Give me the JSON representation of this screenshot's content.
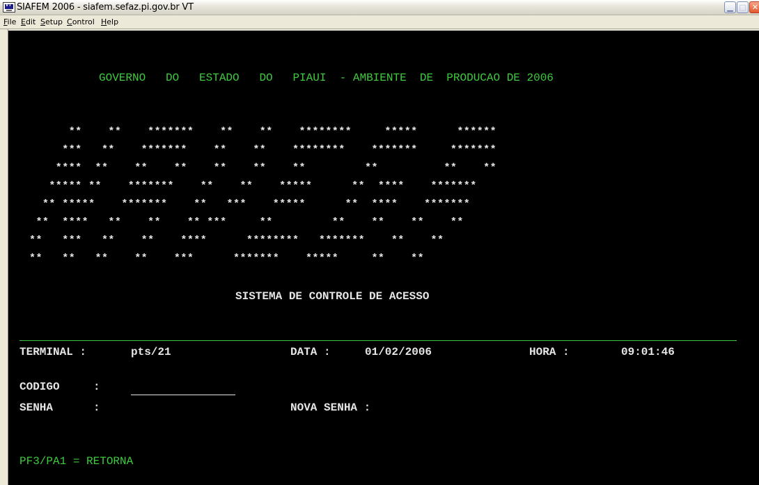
{
  "window": {
    "title": "SIAFEM 2006 - siafem.sefaz.pi.gov.br VT",
    "icon_label": "VT"
  },
  "menu": {
    "items": [
      "File",
      "Edit",
      "Setup",
      "Control",
      "Help"
    ]
  },
  "terminal": {
    "header": "GOVERNO   DO   ESTADO   DO   PIAUI  - AMBIENTE  DE  PRODUCAO DE 2006",
    "ascii_art": [
      "      **    **    *******    **    **    ********     *****      ******",
      "     ***   **    *******    **    **    ********    *******     *******",
      "    ****  **    **    **    **    **    **         **          **    **",
      "   ***** **    *******    **    **    *****      **  ****    *******",
      "  ** *****    *******    **   ***    *****      **  ****    *******",
      " **  ****   **    **    ** ***     **         **    **    **    **",
      "**   ***   **    **    ****      ********   *******    **    **",
      "**   **   **    **    ***      *******    *****     **    **"
    ],
    "system_title": "SISTEMA DE CONTROLE DE ACESSO",
    "terminal_label": "TERMINAL :",
    "terminal_value": "pts/21",
    "data_label": "DATA :",
    "data_value": "01/02/2006",
    "hora_label": "HORA :",
    "hora_value": "09:01:46",
    "codigo_label": "CODIGO",
    "codigo_colon": ":",
    "codigo_value": "",
    "senha_label": "SENHA",
    "senha_colon": ":",
    "nova_senha_label": "NOVA SENHA :",
    "pf_help": "PF3/PA1 = RETORNA"
  },
  "colors": {
    "terminal_bg": "#000000",
    "green": "#3DCB3D",
    "white": "#E6E6E6",
    "cyan": "#52E8DC"
  }
}
